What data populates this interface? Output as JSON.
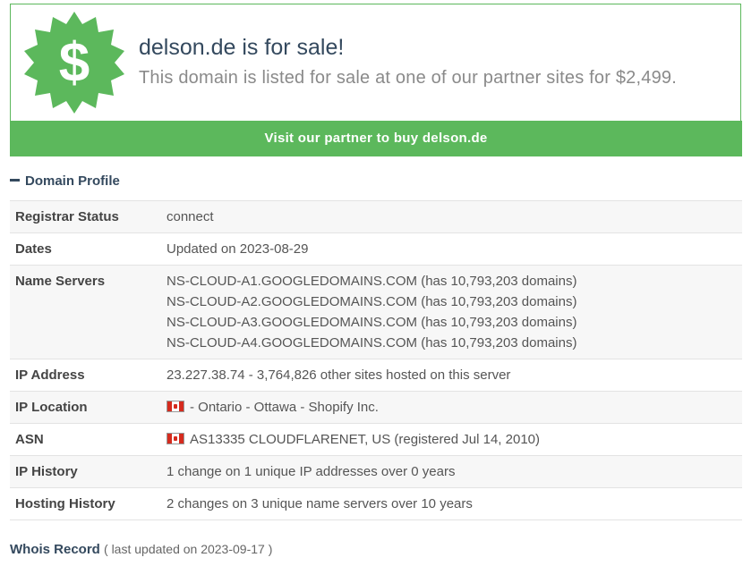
{
  "banner": {
    "title": "delson.de is for sale!",
    "subtitle": "This domain is listed for sale at one of our partner sites for $2,499.",
    "badge_icon": "dollar-badge-icon",
    "badge_color": "#5cb85c",
    "button_label": "Visit our partner to buy delson.de",
    "button_color": "#5cb85c"
  },
  "profile": {
    "header": "Domain Profile",
    "toggle_icon": "minus-icon",
    "rows": [
      {
        "label": "Registrar Status",
        "value": "connect"
      },
      {
        "label": "Dates",
        "value": "Updated on 2023-08-29"
      },
      {
        "label": "Name Servers",
        "values": [
          "NS-CLOUD-A1.GOOGLEDOMAINS.COM (has 10,793,203 domains)",
          "NS-CLOUD-A2.GOOGLEDOMAINS.COM (has 10,793,203 domains)",
          "NS-CLOUD-A3.GOOGLEDOMAINS.COM (has 10,793,203 domains)",
          "NS-CLOUD-A4.GOOGLEDOMAINS.COM (has 10,793,203 domains)"
        ]
      },
      {
        "label": "IP Address",
        "value": "23.227.38.74 - 3,764,826 other sites hosted on this server"
      },
      {
        "label": "IP Location",
        "flag": "canada-flag-icon",
        "value": "- Ontario - Ottawa - Shopify Inc."
      },
      {
        "label": "ASN",
        "flag": "canada-flag-icon",
        "value": "AS13335 CLOUDFLARENET, US (registered Jul 14, 2010)"
      },
      {
        "label": "IP History",
        "value": "1 change on 1 unique IP addresses over 0 years"
      },
      {
        "label": "Hosting History",
        "value": "2 changes on 3 unique name servers over 10 years"
      }
    ]
  },
  "whois": {
    "title": "Whois Record",
    "updated": "( last updated on 2023-09-17 )"
  }
}
